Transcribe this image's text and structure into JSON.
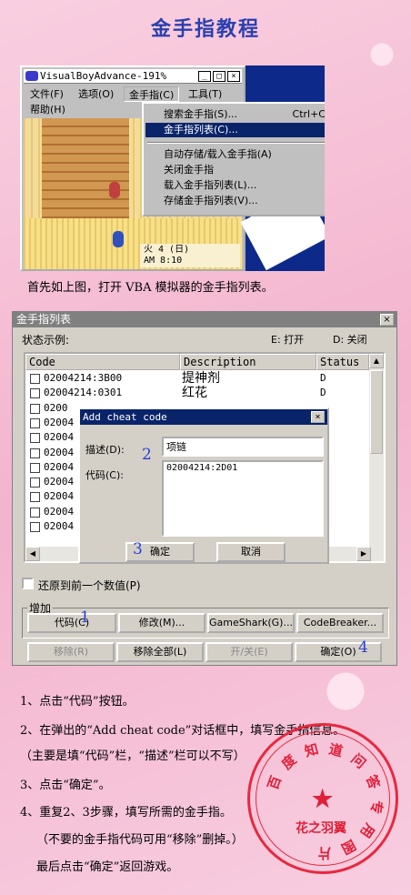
{
  "title": "金手指教程",
  "vba": {
    "window_title": "VisualBoyAdvance-191%",
    "menu": [
      "文件(F)",
      "选项(O)",
      "金手指(C)",
      "工具(T)",
      "帮助(H)"
    ],
    "dropdown": [
      {
        "label": "搜索金手指(S)...",
        "shortcut": "Ctrl+C"
      },
      {
        "label": "金手指列表(C)...",
        "shortcut": ""
      },
      {
        "label": "自动存储/载入金手指(A)",
        "shortcut": ""
      },
      {
        "label": "关闭金手指",
        "shortcut": ""
      },
      {
        "label": "载入金手指列表(L)...",
        "shortcut": ""
      },
      {
        "label": "存储金手指列表(V)...",
        "shortcut": ""
      }
    ],
    "clock_line1": "火 4 (日)",
    "clock_line2": "AM 8:10"
  },
  "caption1": "首先如上图，打开 VBA 模拟器的金手指列表。",
  "list_dialog": {
    "title": "金手指列表",
    "status_example": "状态示例:",
    "legend_on": "E: 打开",
    "legend_off": "D: 关闭",
    "col_code": "Code",
    "col_desc": "Description",
    "col_status": "Status",
    "rows": [
      {
        "code": "02004214:3B00",
        "desc": "提神剂",
        "status": "D"
      },
      {
        "code": "02004214:0301",
        "desc": "红花",
        "status": "D"
      },
      {
        "code": "0200",
        "desc": "",
        "status": ""
      },
      {
        "code": "02004",
        "desc": "",
        "status": ""
      },
      {
        "code": "02004",
        "desc": "",
        "status": ""
      },
      {
        "code": "02004",
        "desc": "",
        "status": ""
      },
      {
        "code": "02004",
        "desc": "",
        "status": ""
      },
      {
        "code": "02004",
        "desc": "",
        "status": ""
      },
      {
        "code": "02004",
        "desc": "",
        "status": ""
      },
      {
        "code": "02004",
        "desc": "",
        "status": ""
      },
      {
        "code": "02004",
        "desc": "",
        "status": ""
      }
    ],
    "restore_label": "还原到前一个数值(P)",
    "group_label": "增加",
    "btn_code": "代码(C)",
    "btn_modify": "修改(M)...",
    "btn_gameshark": "GameShark(G)...",
    "btn_codebreaker": "CodeBreaker...",
    "btn_remove": "移除(R)",
    "btn_remove_all": "移除全部(L)",
    "btn_toggle": "开/关(E)",
    "btn_ok": "确定(O)"
  },
  "add_dialog": {
    "title": "Add cheat code",
    "desc_label": "描述(D):",
    "desc_value": "项链",
    "code_label": "代码(C):",
    "code_value": "02004214:2D01",
    "btn_ok": "确定",
    "btn_cancel": "取消"
  },
  "markers": {
    "m1": "1",
    "m2": "2",
    "m3": "3",
    "m4": "4"
  },
  "steps": [
    "1、点击“代码”按钮。",
    "2、在弹出的“Add cheat code”对话框中，填写金手指信息。",
    "（主要是填“代码”栏，“描述”栏可以不写）",
    "3、点击“确定”。",
    "4、重复2、3步骤，填写所需的金手指。",
    "（不要的金手指代码可用“移除”删掉。）",
    "最后点击“确定”返回游戏。"
  ],
  "stamp": {
    "ring_text": "百度知道问答专用图片",
    "center": "花之羽翼"
  }
}
